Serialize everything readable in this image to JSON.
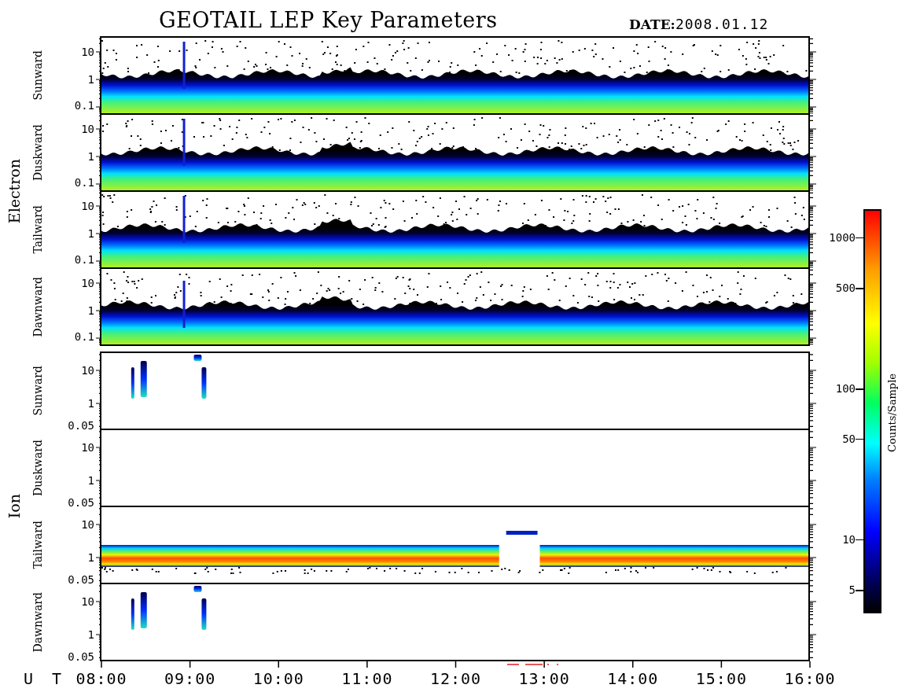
{
  "title": "GEOTAIL LEP Key Parameters",
  "date": {
    "label": "DATE:",
    "value": "2008.01.12"
  },
  "groups": [
    {
      "name": "Electron",
      "panels": [
        {
          "name": "Sunward",
          "kind": "electron",
          "yticks": [
            "10",
            "1",
            "0.1"
          ]
        },
        {
          "name": "Duskward",
          "kind": "electron",
          "yticks": [
            "10",
            "1",
            "0.1"
          ]
        },
        {
          "name": "Tailward",
          "kind": "electron",
          "yticks": [
            "10",
            "1",
            "0.1"
          ]
        },
        {
          "name": "Dawnward",
          "kind": "electron",
          "yticks": [
            "10",
            "1",
            "0.1"
          ]
        }
      ]
    },
    {
      "name": "Ion",
      "panels": [
        {
          "name": "Sunward",
          "kind": "bursts",
          "yticks": [
            "10",
            "1",
            "0.05"
          ]
        },
        {
          "name": "Duskward",
          "kind": "empty",
          "yticks": [
            "10",
            "1",
            "0.05"
          ]
        },
        {
          "name": "Tailward",
          "kind": "band",
          "yticks": [
            "10",
            "1",
            "0.05"
          ]
        },
        {
          "name": "Dawnward",
          "kind": "bursts",
          "yticks": [
            "10",
            "1",
            "0.05"
          ]
        }
      ]
    }
  ],
  "time_axis": {
    "label": "U T",
    "ticks": [
      "08:00",
      "09:00",
      "10:00",
      "11:00",
      "12:00",
      "13:00",
      "14:00",
      "15:00",
      "16:00"
    ]
  },
  "colorbar": {
    "label": "Counts/Sample",
    "ticks": [
      "1000",
      "500",
      "100",
      "50",
      "10",
      "5"
    ]
  }
}
